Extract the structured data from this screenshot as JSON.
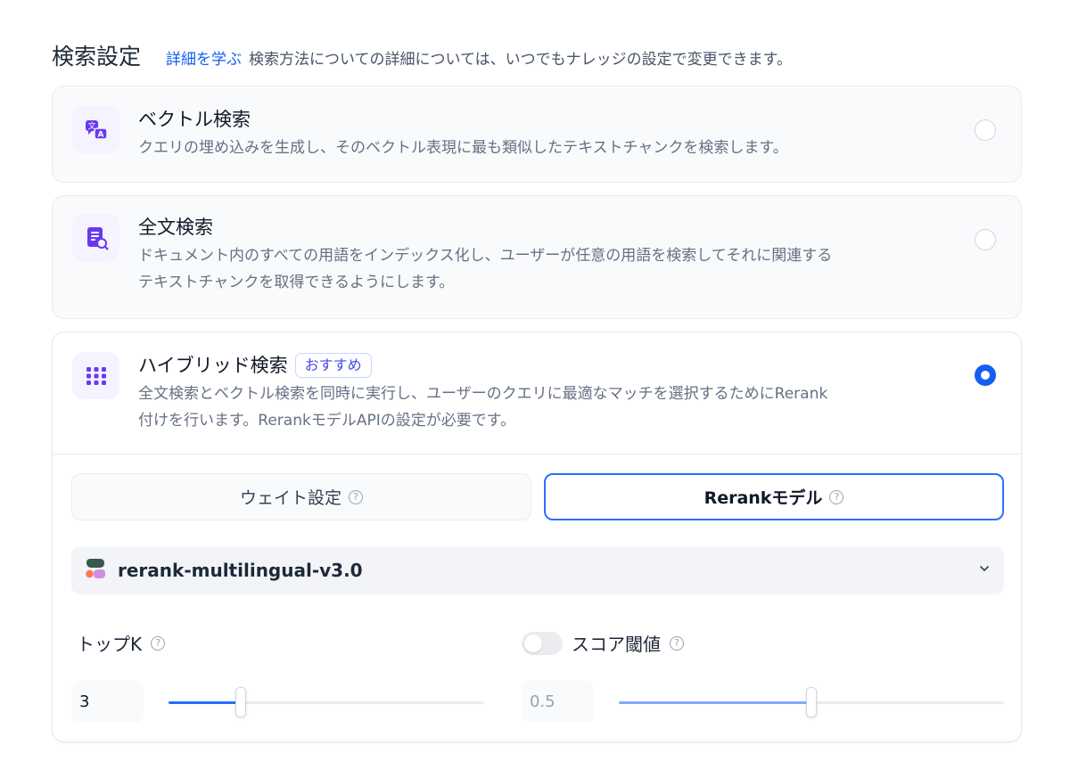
{
  "header": {
    "title": "検索設定",
    "learn_link": "詳細を学ぶ",
    "description": "検索方法についての詳細については、いつでもナレッジの設定で変更できます。"
  },
  "methods": [
    {
      "title": "ベクトル検索",
      "description": "クエリの埋め込みを生成し、そのベクトル表現に最も類似したテキストチャンクを検索します。",
      "icon": "vector-search-icon",
      "selected": false
    },
    {
      "title": "全文検索",
      "description_line1": "ドキュメント内のすべての用語をインデックス化し、ユーザーが任意の用語を検索してそれに関連する",
      "description_line2": "テキストチャンクを取得できるようにします。",
      "icon": "fulltext-search-icon",
      "selected": false
    },
    {
      "title": "ハイブリッド検索",
      "badge": "おすすめ",
      "description_line1": "全文検索とベクトル検索を同時に実行し、ユーザーのクエリに最適なマッチを選択するためにRerank",
      "description_line2": "付けを行います。RerankモデルAPIの設定が必要です。",
      "icon": "hybrid-search-icon",
      "selected": true
    }
  ],
  "tabs": [
    {
      "label": "ウェイト設定",
      "active": false
    },
    {
      "label": "Rerankモデル",
      "active": true
    }
  ],
  "rerank_model": {
    "name": "rerank-multilingual-v3.0"
  },
  "top_k": {
    "label": "トップK",
    "value": "3",
    "slider_fraction": 0.23
  },
  "score_threshold": {
    "label": "スコア閾値",
    "value": "0.5",
    "enabled": false,
    "slider_fraction": 0.5
  },
  "colors": {
    "accent": "#155eef",
    "icon_purple": "#6938ef",
    "slider_fill": "#296dff",
    "slider_fill_disabled": "#84a9f8"
  }
}
